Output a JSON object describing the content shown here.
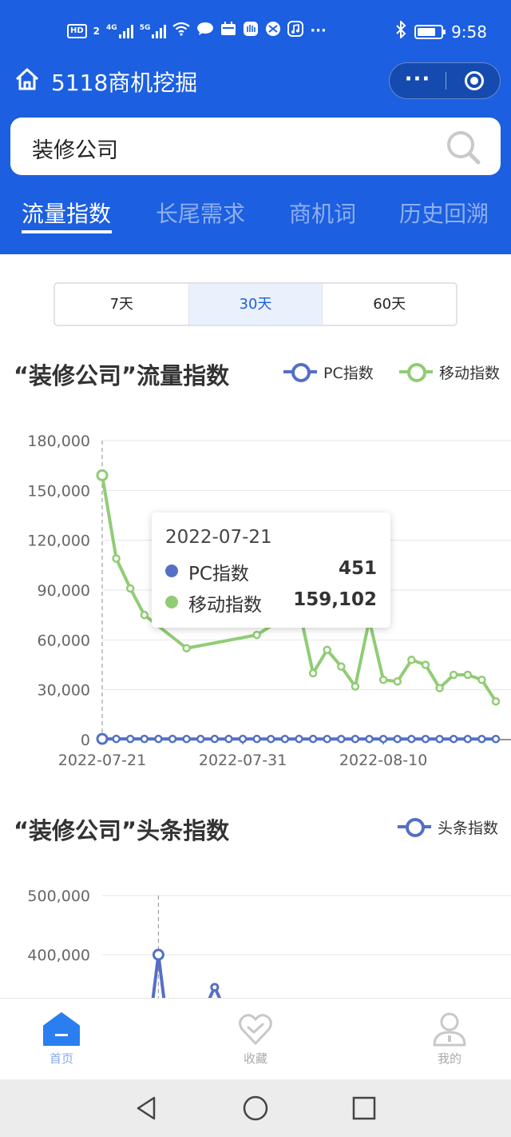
{
  "status_bar": {
    "hd_badge": "HD",
    "sim1": "2",
    "net1": "4G",
    "net2": "5G",
    "more": "···",
    "time": "9:58"
  },
  "header": {
    "app_title": "5118商机挖掘",
    "more_icon": "···"
  },
  "search": {
    "value": "装修公司"
  },
  "tabs": [
    {
      "label": "流量指数",
      "active": true
    },
    {
      "label": "长尾需求",
      "active": false
    },
    {
      "label": "商机词",
      "active": false
    },
    {
      "label": "历史回溯",
      "active": false
    }
  ],
  "range": {
    "options": [
      "7天",
      "30天",
      "60天"
    ],
    "selected": "30天"
  },
  "traffic_section": {
    "title": "“装修公司”流量指数",
    "legend_pc": "PC指数",
    "legend_mobile": "移动指数"
  },
  "toutiao_section": {
    "title": "“装修公司”头条指数",
    "legend": "头条指数"
  },
  "tooltip": {
    "date": "2022-07-21",
    "pc_label": "PC指数",
    "pc_value": "451",
    "mobile_label": "移动指数",
    "mobile_value": "159,102"
  },
  "chart_data": [
    {
      "type": "line",
      "x": [
        "2022-07-21",
        "2022-07-22",
        "2022-07-23",
        "2022-07-24",
        "2022-07-25",
        "2022-07-26",
        "2022-07-27",
        "2022-07-28",
        "2022-07-29",
        "2022-07-30",
        "2022-07-31",
        "2022-08-01",
        "2022-08-02",
        "2022-08-03",
        "2022-08-04",
        "2022-08-05",
        "2022-08-06",
        "2022-08-07",
        "2022-08-08",
        "2022-08-09",
        "2022-08-10",
        "2022-08-11",
        "2022-08-12",
        "2022-08-13",
        "2022-08-14",
        "2022-08-15",
        "2022-08-16",
        "2022-08-17",
        "2022-08-18"
      ],
      "x_tick_labels": [
        "2022-07-21",
        "2022-07-31",
        "2022-08-10"
      ],
      "series": [
        {
          "name": "PC指数",
          "color": "#5470c6",
          "values": [
            451,
            420,
            430,
            410,
            400,
            415,
            390,
            405,
            400,
            395,
            410,
            400,
            390,
            385,
            400,
            395,
            380,
            390,
            385,
            380,
            375,
            390,
            380,
            385,
            370,
            380,
            375,
            370,
            365
          ]
        },
        {
          "name": "移动指数",
          "color": "#91cc75",
          "values": [
            159102,
            109000,
            91000,
            75000,
            null,
            null,
            55000,
            null,
            null,
            null,
            null,
            63000,
            null,
            null,
            79000,
            40000,
            54000,
            44000,
            32000,
            72000,
            36000,
            35000,
            48000,
            45000,
            31000,
            39000,
            39000,
            36000,
            23000
          ]
        }
      ],
      "ylim": [
        0,
        180000
      ],
      "y_ticks": [
        0,
        30000,
        60000,
        90000,
        120000,
        150000,
        180000
      ],
      "y_tick_labels": [
        "0",
        "30,000",
        "60,000",
        "90,000",
        "120,000",
        "150,000",
        "180,000"
      ],
      "grid": true,
      "legend": "top-right"
    },
    {
      "type": "line",
      "series": [
        {
          "name": "头条指数",
          "color": "#5470c6",
          "points": [
            {
              "x": "2022-07-25",
              "y": 400000
            },
            {
              "x": "2022-07-29",
              "y": 345000
            }
          ]
        }
      ],
      "y_ticks": [
        400000,
        500000
      ],
      "y_tick_labels": [
        "400,000",
        "500,000"
      ],
      "grid": true,
      "legend": "top-right"
    }
  ],
  "bottom_nav": [
    {
      "label": "首页",
      "active": true
    },
    {
      "label": "收藏",
      "active": false
    },
    {
      "label": "我的",
      "active": false
    }
  ]
}
